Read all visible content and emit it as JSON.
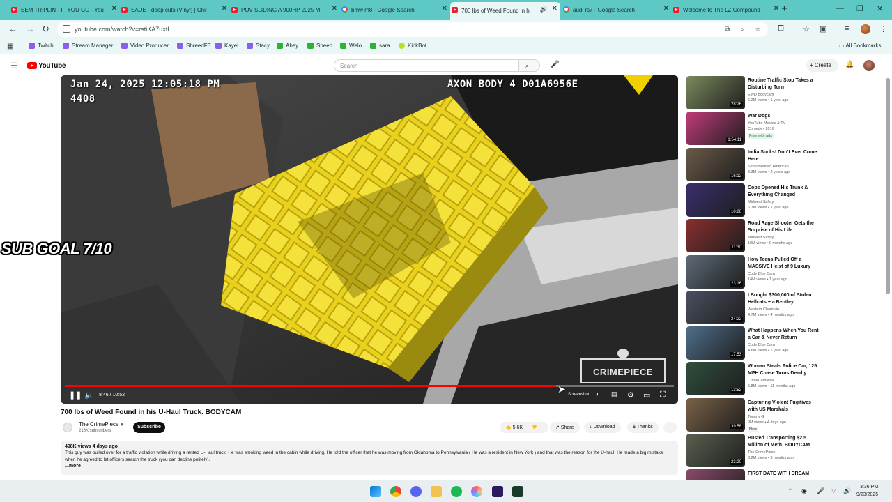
{
  "browser": {
    "tabs": [
      {
        "title": "EEM TRIPLIN - IF YOU GO - You",
        "favicon": "youtube-icon"
      },
      {
        "title": "SADE - deep cuts (Vinyl) | Chil",
        "favicon": "youtube-icon"
      },
      {
        "title": "POV SLIDING A 900HP 2025 M",
        "favicon": "youtube-icon"
      },
      {
        "title": "bmw m8 - Google Search",
        "favicon": "google-icon"
      },
      {
        "title": "700 lbs of Weed Found in his",
        "favicon": "youtube-icon",
        "active": true
      },
      {
        "title": "audi rs7 - Google Search",
        "favicon": "google-icon"
      },
      {
        "title": "Welcome to The LZ Compound",
        "favicon": "youtube-icon"
      }
    ],
    "url": "youtube.com/watch?v=rstiKA7uxtI",
    "bookmarks": [
      "Twitch",
      "Stream Manager",
      "Video Producer",
      "ShreedFE",
      "Kayel",
      "Stacy",
      "Abey",
      "Sheed",
      "Welo",
      "sara",
      "KickBot"
    ],
    "all_bookmarks": "All Bookmarks"
  },
  "youtube": {
    "logo_text": "YouTube",
    "search_placeholder": "Search",
    "create_label": "Create"
  },
  "player": {
    "osd_date": "Jan 24, 2025 12:05:18 PM",
    "osd_id": "4408",
    "osd_camera": "AXON BODY 4 D01A6956E",
    "watermark": "CRIMEPIECE",
    "time_current": "8:46",
    "time_total": "10:52",
    "progress_fraction": 0.807,
    "screenshot_tooltip": "Screenshot"
  },
  "overlay": {
    "sub_goal": "SUB GOAL 7/10"
  },
  "video": {
    "title": "700 lbs of Weed Found in his U-Haul Truck. BODYCAM",
    "channel": "The CrimePiece",
    "subscribers": "216K subscribers",
    "subscribe_label": "Subscribe",
    "likes": "5.6K",
    "share": "Share",
    "download": "Download",
    "thanks": "Thanks",
    "views_date": "498K views  4 days ago",
    "description": "This guy was pulled over for a traffic violation while driving a rented U-Haul truck. He was smoking weed in the cabin while driving. He told the officer that he was moving from Oklahoma to Pennsylvania ( He was a resident in New York ) and that was the reason for the U-haul. He made a big mistake when he agreed to let officers search the truck (you can decline politely).",
    "more": "...more"
  },
  "recommendations": [
    {
      "title": "Routine Traffic Stop Takes a Disturbing Turn",
      "channel": "EWD Bodycam",
      "meta": "6.2M views • 1 year ago",
      "duration": "28:26",
      "color": "#7a8a5e"
    },
    {
      "title": "War Dogs",
      "channel": "YouTube Movies & TV",
      "meta": "Comedy • 2016",
      "tag": "Free with ads",
      "duration": "1:54:11",
      "color": "#c23b7a"
    },
    {
      "title": "India Sucks! Don't Ever Come Here",
      "channel": "Small Brained American",
      "meta": "3.3M views • 2 years ago",
      "duration": "16:12",
      "color": "#6a5a48"
    },
    {
      "title": "Cops Opened His Trunk & Everything Changed",
      "channel": "Midwest Safety",
      "meta": "6.7M views • 1 year ago",
      "duration": "10:26",
      "color": "#3a2e6e"
    },
    {
      "title": "Road Rage Shooter Gets the Surprise of His Life",
      "channel": "Midwest Safety",
      "meta": "10M views • 9 months ago",
      "duration": "11:30",
      "color": "#8a2f2f"
    },
    {
      "title": "How Teens Pulled Off a MASSIVE Heist of 9 Luxury Cars",
      "channel": "Code Blue Cam",
      "meta": "14M views • 1 year ago",
      "duration": "23:16",
      "color": "#5d6a78"
    },
    {
      "title": "I Bought $300,000 of Stolen Hellcats + a Bentley",
      "channel": "Western Champlin",
      "meta": "4.7M views • 4 months ago",
      "duration": "24:22",
      "color": "#4a5060"
    },
    {
      "title": "What Happens When You Rent a Car & Never Return",
      "channel": "Code Blue Cam",
      "meta": "4.6M views • 1 year ago",
      "duration": "17:53",
      "color": "#4f6f8a"
    },
    {
      "title": "Woman Steals Police Car, 125 MPH Chase Turns Deadly",
      "channel": "CrimeCamNow",
      "meta": "5.8M views • 11 months ago",
      "duration": "13:52",
      "color": "#2f4f3e"
    },
    {
      "title": "Capturing Violent Fugitives with US Marshals",
      "channel": "Tommy G",
      "meta": "9M views • 4 days ago",
      "tag": "New",
      "duration": "39:58",
      "color": "#7a6248"
    },
    {
      "title": "Busted Transporting $2.5 Million of Meth. BODYCAM",
      "channel": "The CrimePiece",
      "meta": "3.2M views • 8 months ago",
      "duration": "23:20",
      "color": "#5a6050"
    },
    {
      "title": "FIRST DATE WITH DREAM",
      "channel": "",
      "meta": "",
      "duration": "",
      "color": "#8a4a6a"
    }
  ],
  "taskbar": {
    "time": "3:36 PM",
    "date": "9/23/2025"
  }
}
